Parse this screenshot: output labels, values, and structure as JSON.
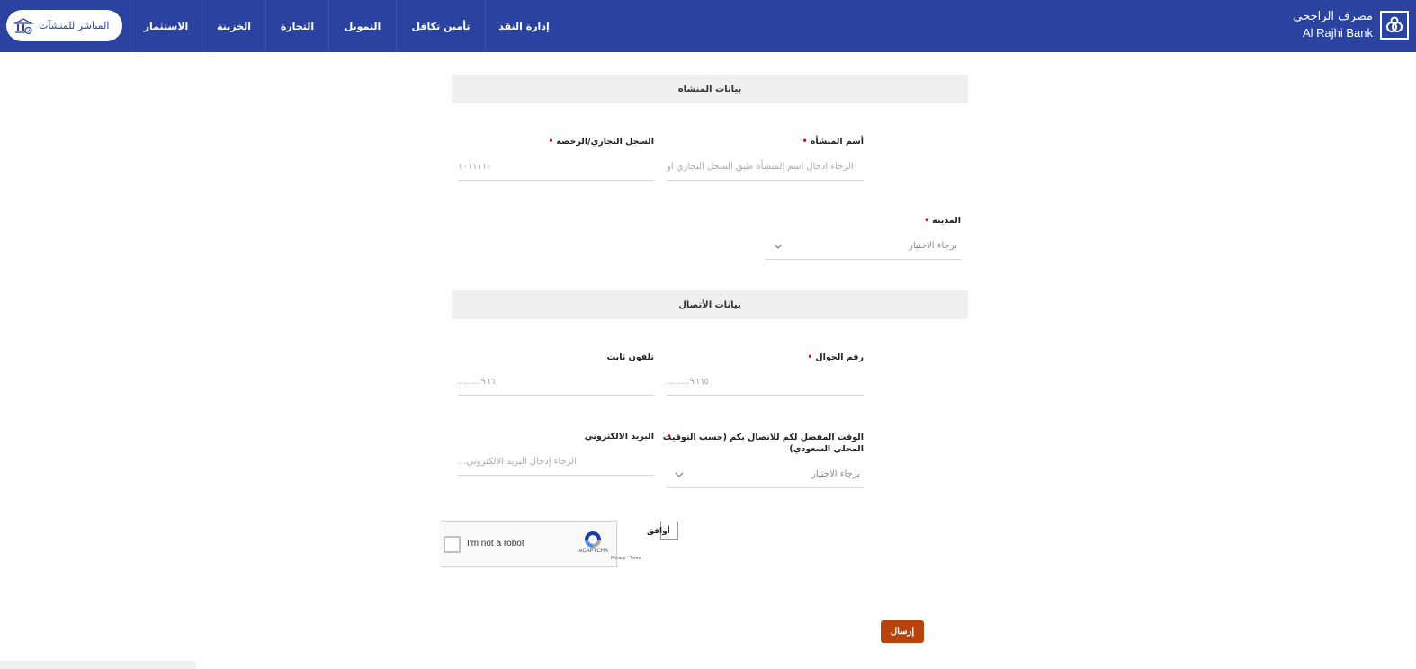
{
  "header": {
    "brand_ar": "مصرف الراجحي",
    "brand_en": "Al Rajhi Bank",
    "nav": [
      "إدارة النقد",
      "تأمين تكافل",
      "التمويل",
      "التجارة",
      "الخزينة",
      "الاستثمار"
    ],
    "direct_button": "المباشر للمنشآت",
    "colors": {
      "bar": "#2a43a0",
      "accent": "#b8430d"
    }
  },
  "section_org": {
    "title": "بيانات المنشاه"
  },
  "org_name": {
    "label": "أسم المنشأه",
    "placeholder": "الرجاء ادخال اسم المنشأة طبق السجل التجاري او"
  },
  "cr": {
    "label": "السجل التجاري/الرخصه",
    "placeholder": "١٠١١١١٠"
  },
  "city": {
    "label": "المدينة",
    "value": "برجاء الاختيار"
  },
  "section_contact": {
    "title": "بيانات الأتصال"
  },
  "mobile": {
    "label": "رقم الجوال",
    "placeholder": "٩٦٦٥........"
  },
  "landline": {
    "label": "تلفون ثابت",
    "placeholder": "٩٦٦........"
  },
  "preferred_time": {
    "label_line1": "الوقت المفضل لكم للاتصال بكم (حسب التوقيت",
    "label_line2": "المحلي السعودي)",
    "value": "برجاء الاختيار"
  },
  "email": {
    "label": "البريد الالكتروني",
    "placeholder": "الرجاء إدخال البريد الالكتروني..."
  },
  "agree": {
    "label": "أوافق"
  },
  "captcha": {
    "text": "I'm not a robot",
    "brand": "reCAPTCHA",
    "links": "Privacy - Terms"
  },
  "submit": {
    "label": "إرسال"
  }
}
